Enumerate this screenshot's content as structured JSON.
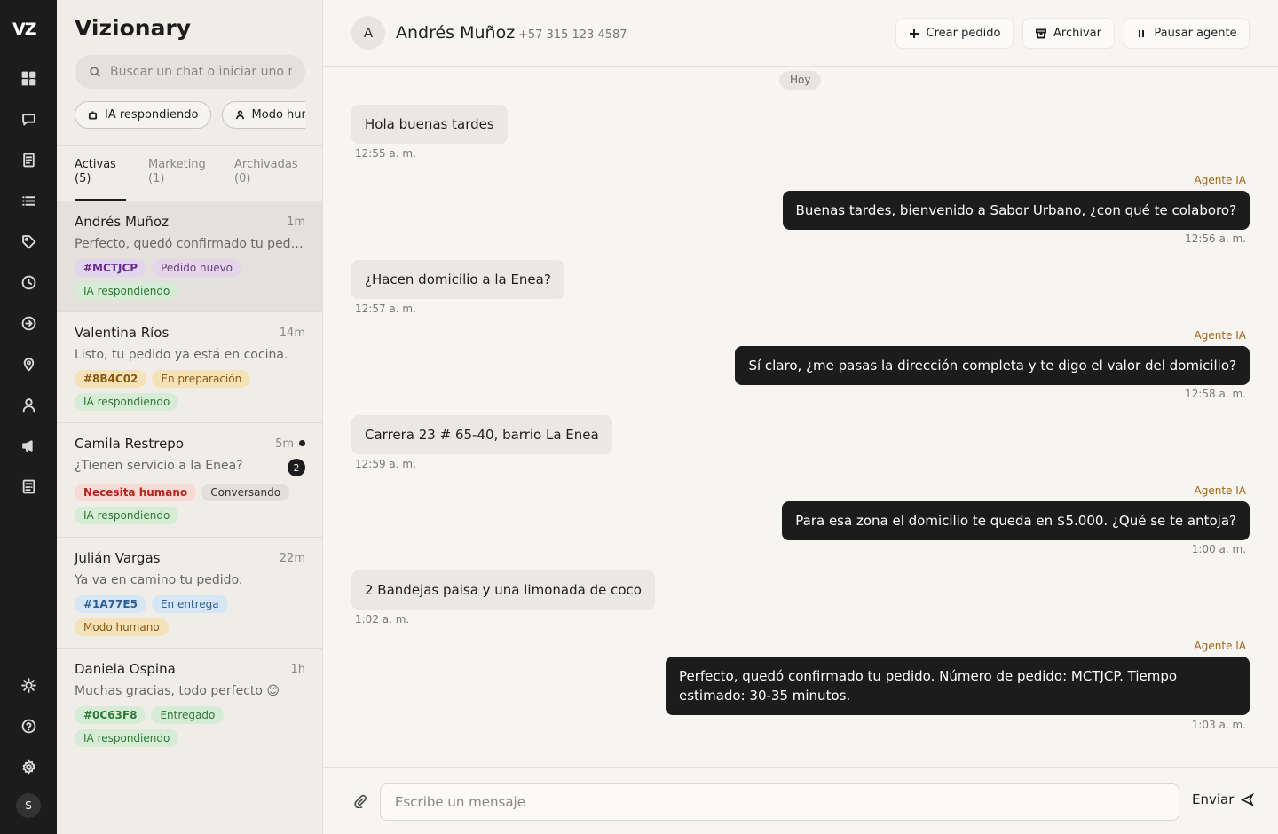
{
  "rail": {
    "logo": "VZ",
    "avatar": "S"
  },
  "sidebar": {
    "brand": "Vizionary",
    "search_placeholder": "Buscar un chat o iniciar uno nuevo",
    "filters": [
      "IA respondiendo",
      "Modo humano"
    ],
    "tabs": [
      {
        "label": "Activas",
        "count": "(5)"
      },
      {
        "label": "Marketing",
        "count": "(1)"
      },
      {
        "label": "Archivadas",
        "count": "(0)"
      }
    ],
    "chats": [
      {
        "name": "Andrés Muñoz",
        "time": "1m",
        "preview": "Perfecto, quedó confirmado tu pedido. Número de pedido: MCTJCP.",
        "order": "#MCTJCP",
        "status": "Pedido nuevo",
        "mode": "IA respondiendo"
      },
      {
        "name": "Valentina Ríos",
        "time": "14m",
        "preview": "Listo, tu pedido ya está en cocina.",
        "order": "#8B4C02",
        "status": "En preparación",
        "mode": "IA respondiendo"
      },
      {
        "name": "Camila Restrepo",
        "time": "5m",
        "preview": "¿Tienen servicio a la Enea?",
        "unread": "2",
        "alert": "Necesita humano",
        "status": "Conversando",
        "mode": "IA respondiendo"
      },
      {
        "name": "Julián Vargas",
        "time": "22m",
        "preview": "Ya va en camino tu pedido.",
        "order": "#1A77E5",
        "status": "En entrega",
        "mode": "Modo humano"
      },
      {
        "name": "Daniela Ospina",
        "time": "1h",
        "preview": "Muchas gracias, todo perfecto 😊",
        "order": "#0C63F8",
        "status": "Entregado",
        "mode": "IA respondiendo"
      }
    ]
  },
  "header": {
    "avatar_letter": "A",
    "name": "Andrés Muñoz",
    "phone": "+57 315 123 4587",
    "buttons": {
      "create": "Crear pedido",
      "archive": "Archivar",
      "pause": "Pausar agente"
    }
  },
  "conversation": {
    "date": "Hoy",
    "agent_label": "Agente IA",
    "messages": [
      {
        "text": "Hola buenas tardes",
        "time": "12:55 a. m."
      },
      {
        "text": "Buenas tardes, bienvenido a Sabor Urbano, ¿con qué te colaboro?",
        "time": "12:56 a. m."
      },
      {
        "text": "¿Hacen domicilio a la Enea?",
        "time": "12:57 a. m."
      },
      {
        "text": "Sí claro, ¿me pasas la dirección completa y te digo el valor del domicilio?",
        "time": "12:58 a. m."
      },
      {
        "text": "Carrera 23 # 65-40, barrio La Enea",
        "time": "12:59 a. m."
      },
      {
        "text": "Para esa zona el domicilio te queda en $5.000. ¿Qué se te antoja?",
        "time": "1:00 a. m."
      },
      {
        "text": "2 Bandejas paisa y una limonada de coco",
        "time": "1:02 a. m."
      },
      {
        "text": "Perfecto, quedó confirmado tu pedido. Número de pedido: MCTJCP. Tiempo estimado: 30-35 minutos.",
        "time": "1:03 a. m."
      }
    ]
  },
  "composer": {
    "placeholder": "Escribe un mensaje",
    "send_label": "Enviar"
  }
}
